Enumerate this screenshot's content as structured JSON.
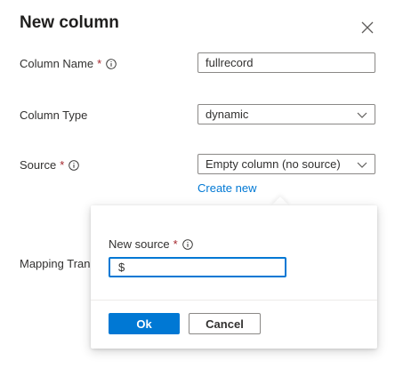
{
  "panel": {
    "title": "New column",
    "close_icon": "close-icon"
  },
  "fields": {
    "column_name": {
      "label": "Column Name",
      "required_mark": "*",
      "value": "fullrecord"
    },
    "column_type": {
      "label": "Column Type",
      "selected": "dynamic"
    },
    "source": {
      "label": "Source",
      "required_mark": "*",
      "selected": "Empty column (no source)",
      "create_link": "Create new"
    },
    "mapping_transformation": {
      "label_visible": "Mapping Tran"
    }
  },
  "callout": {
    "label": "New source",
    "required_mark": "*",
    "input_value": "$",
    "ok_label": "Ok",
    "cancel_label": "Cancel"
  },
  "colors": {
    "accent": "#0078d4",
    "required": "#a4262c",
    "border": "#8a8886",
    "text": "#323130"
  }
}
